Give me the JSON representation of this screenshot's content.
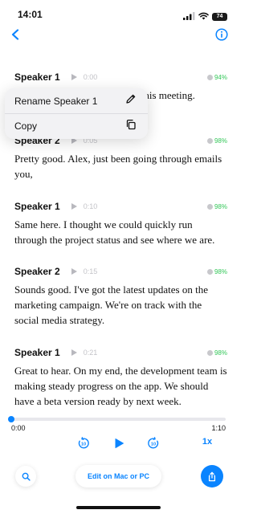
{
  "status_bar": {
    "time": "14:01",
    "battery": "74",
    "icons": [
      "signal-icon",
      "wifi-icon",
      "battery-icon"
    ]
  },
  "nav": {
    "back_icon": "chevron-left-icon",
    "info_icon": "info-icon"
  },
  "colors": {
    "accent": "#0a84ff",
    "confidence": "#34c759",
    "muted_time": "#c3c3c8",
    "menu_background": "#f2f2f4"
  },
  "segments": [
    {
      "speaker": "Speaker 1",
      "time": "0:00",
      "confidence": "94%",
      "text": "g this meeting."
    },
    {
      "speaker": "Speaker 2",
      "time": "0:05",
      "confidence": "98%",
      "text": "Pretty good. Alex, just been going through emails you,"
    },
    {
      "speaker": "Speaker 1",
      "time": "0:10",
      "confidence": "98%",
      "text": "Same here. I thought we could quickly run through the project status and see where we are."
    },
    {
      "speaker": "Speaker 2",
      "time": "0:15",
      "confidence": "98%",
      "text": "Sounds good. I've got the latest updates on the marketing campaign. We're on track with the social media strategy."
    },
    {
      "speaker": "Speaker 1",
      "time": "0:21",
      "confidence": "98%",
      "text": "Great to hear. On my end, the development team is making steady progress on the app. We should have a beta version ready by next week."
    }
  ],
  "context_menu": {
    "items": [
      {
        "label": "Rename Speaker 1",
        "icon": "pencil-icon"
      },
      {
        "label": "Copy",
        "icon": "copy-icon"
      }
    ]
  },
  "player": {
    "current_time": "0:00",
    "total_time": "1:10",
    "progress": 0,
    "skip_back_seconds": "10",
    "skip_forward_seconds": "10",
    "speed": "1x"
  },
  "toolbar": {
    "search_icon": "search-icon",
    "edit_label": "Edit on Mac or PC",
    "share_icon": "share-icon"
  }
}
